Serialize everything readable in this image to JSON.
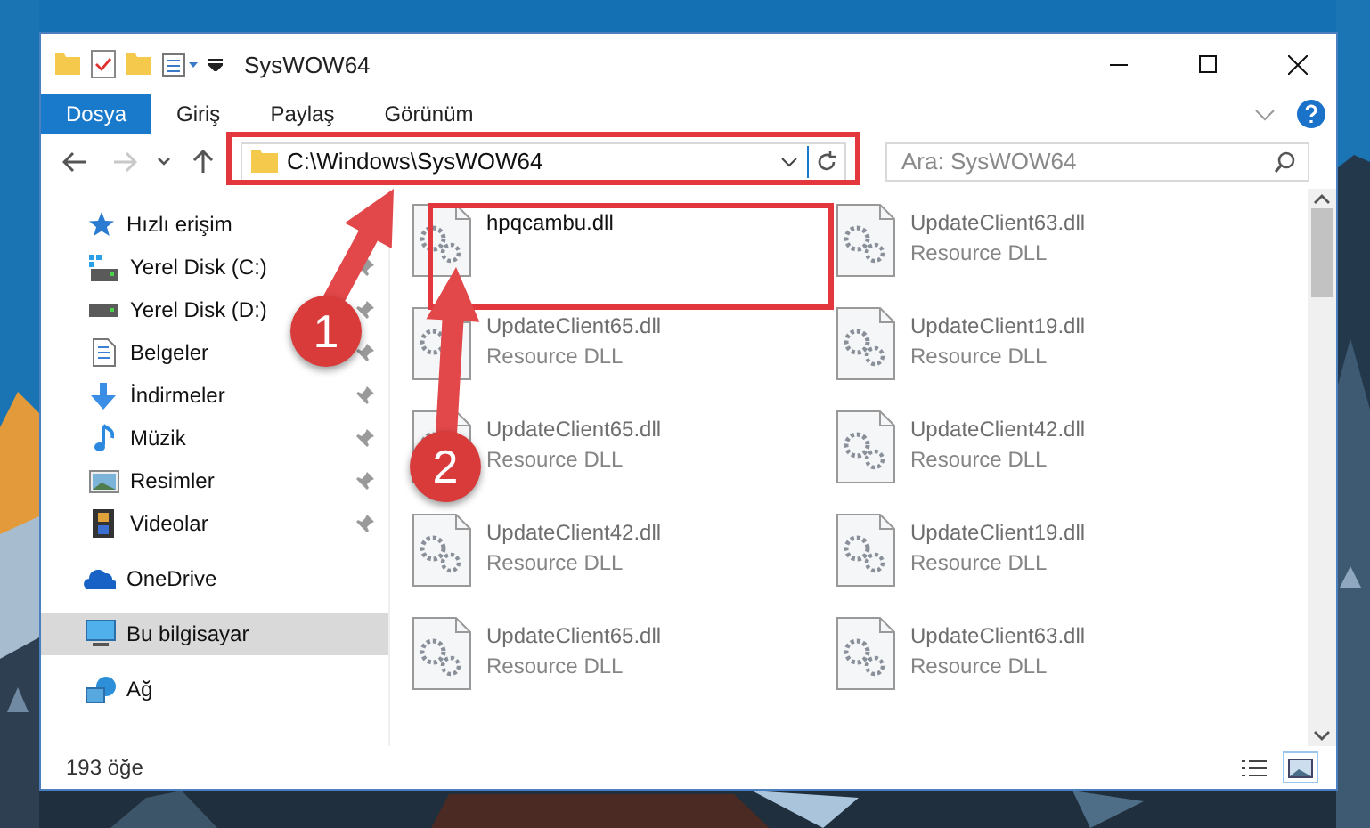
{
  "window": {
    "title": "SysWOW64"
  },
  "ribbon_tabs": [
    {
      "label": "Dosya",
      "selected": true
    },
    {
      "label": "Giriş",
      "selected": false
    },
    {
      "label": "Paylaş",
      "selected": false
    },
    {
      "label": "Görünüm",
      "selected": false
    }
  ],
  "nav_buttons": [
    {
      "kind": "back",
      "disabled": false
    },
    {
      "kind": "forward",
      "disabled": true
    },
    {
      "kind": "recent",
      "disabled": false
    },
    {
      "kind": "up",
      "disabled": false
    }
  ],
  "address": {
    "value": "C:\\Windows\\SysWOW64"
  },
  "search": {
    "placeholder": "Ara: SysWOW64"
  },
  "sidebar": {
    "items": [
      {
        "label": "Hızlı erişim",
        "kind": "star",
        "selected": false,
        "pinned": false,
        "children": [
          {
            "label": "Yerel Disk (C:)",
            "kind": "windrive",
            "selected": false,
            "pinned": true
          },
          {
            "label": "Yerel Disk (D:)",
            "kind": "drive",
            "selected": false,
            "pinned": true
          },
          {
            "label": "Belgeler",
            "kind": "docs",
            "selected": false,
            "pinned": true
          },
          {
            "label": "İndirmeler",
            "kind": "download",
            "selected": false,
            "pinned": true
          },
          {
            "label": "Müzik",
            "kind": "music",
            "selected": false,
            "pinned": true
          },
          {
            "label": "Resimler",
            "kind": "pictures",
            "selected": false,
            "pinned": true
          },
          {
            "label": "Videolar",
            "kind": "video",
            "selected": false,
            "pinned": true
          }
        ]
      },
      {
        "label": "OneDrive",
        "kind": "cloud",
        "selected": false,
        "pinned": false
      },
      {
        "label": "Bu bilgisayar",
        "kind": "pc",
        "selected": true,
        "pinned": false
      },
      {
        "label": "Ağ",
        "kind": "network",
        "selected": false,
        "pinned": false
      }
    ]
  },
  "files": [
    {
      "name": "hpqcambu.dll",
      "faded": false
    },
    {
      "name": "UpdateClient63.dll",
      "type": "Resource DLL",
      "faded": true
    },
    {
      "name": "UpdateClient65.dll",
      "type": "Resource DLL",
      "faded": true
    },
    {
      "name": "UpdateClient19.dll",
      "type": "Resource DLL",
      "faded": true
    },
    {
      "name": "UpdateClient65.dll",
      "type": "Resource DLL",
      "faded": true
    },
    {
      "name": "UpdateClient42.dll",
      "type": "Resource DLL",
      "faded": true
    },
    {
      "name": "UpdateClient42.dll",
      "type": "Resource DLL",
      "faded": true
    },
    {
      "name": "UpdateClient19.dll",
      "type": "Resource DLL",
      "faded": true
    },
    {
      "name": "UpdateClient65.dll",
      "type": "Resource DLL",
      "faded": true
    },
    {
      "name": "UpdateClient63.dll",
      "type": "Resource DLL",
      "faded": true
    }
  ],
  "status_bar": {
    "count": "193 öğe"
  },
  "view_buttons": [
    {
      "kind": "details",
      "selected": false
    },
    {
      "kind": "icons",
      "selected": true
    }
  ],
  "callouts": [
    {
      "number": "1"
    },
    {
      "number": "2"
    }
  ]
}
